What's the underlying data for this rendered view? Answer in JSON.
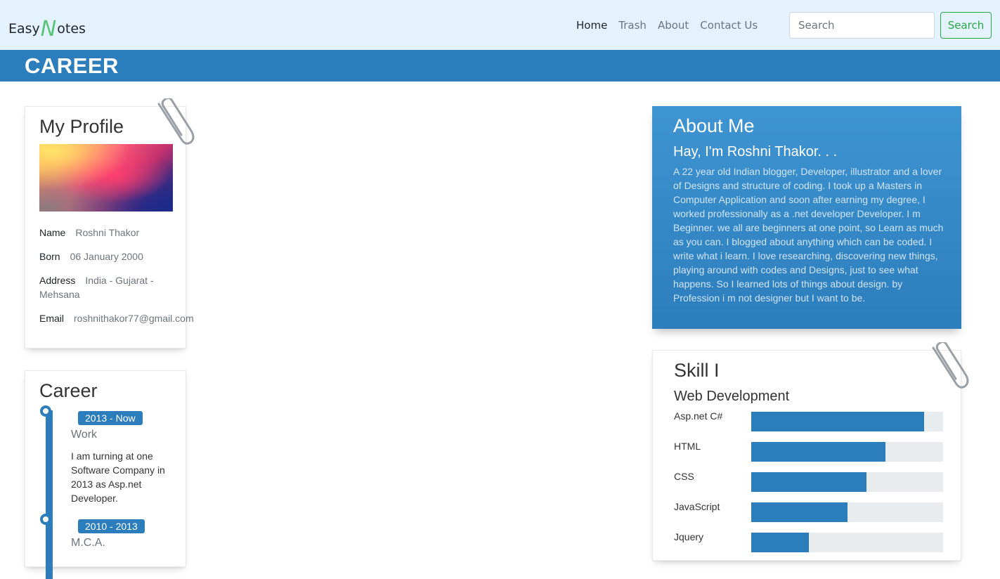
{
  "navbar": {
    "brand_prefix": "Easy",
    "brand_accent": "N",
    "brand_suffix": "otes",
    "links": [
      "Home",
      "Trash",
      "About",
      "Contact Us"
    ],
    "search_placeholder": "Search",
    "search_button": "Search"
  },
  "banner": {
    "title": "CAREER"
  },
  "profile": {
    "title": "My Profile",
    "name_label": "Name",
    "name_value": "Roshni Thakor",
    "born_label": "Born",
    "born_value": "06 January 2000",
    "address_label": "Address",
    "address_value": "India - Gujarat - Mehsana",
    "email_label": "Email",
    "email_value": "roshnithakor77@gmail.com"
  },
  "career": {
    "title": "Career",
    "items": [
      {
        "period": "2013 - Now",
        "title": "Work",
        "desc": "I am turning at one Software Company in 2013 as Asp.net Developer."
      },
      {
        "period": "2010 - 2013",
        "title": "M.C.A.",
        "desc": ""
      }
    ]
  },
  "about": {
    "title": "About Me",
    "subtitle": "Hay, I'm Roshni Thakor. . .",
    "text": "A 22 year old Indian blogger, Developer, illustrator and a lover of Designs and structure of coding. I took up a Masters in Computer Application and soon after earning my degree, I worked professionally as a .net developer Developer. I m Beginner. we all are beginners at one point, so Learn as much as you can. I blogged about anything which can be coded. I write what i learn. I love researching, discovering new things, playing around with codes and Designs, just to see what happens. So I learned lots of things about design. by Profession i m not designer but I want to be."
  },
  "skills": {
    "title": "Skill I",
    "subtitle": "Web Development",
    "items": [
      {
        "name": "Asp.net C#",
        "level": 0.9
      },
      {
        "name": "HTML",
        "level": 0.7
      },
      {
        "name": "CSS",
        "level": 0.6
      },
      {
        "name": "JavaScript",
        "level": 0.5
      },
      {
        "name": "Jquery",
        "level": 0.3
      }
    ]
  },
  "colors": {
    "primary": "#2c7dbb",
    "navbar_bg": "#e3f2fd",
    "success": "#28a745"
  }
}
